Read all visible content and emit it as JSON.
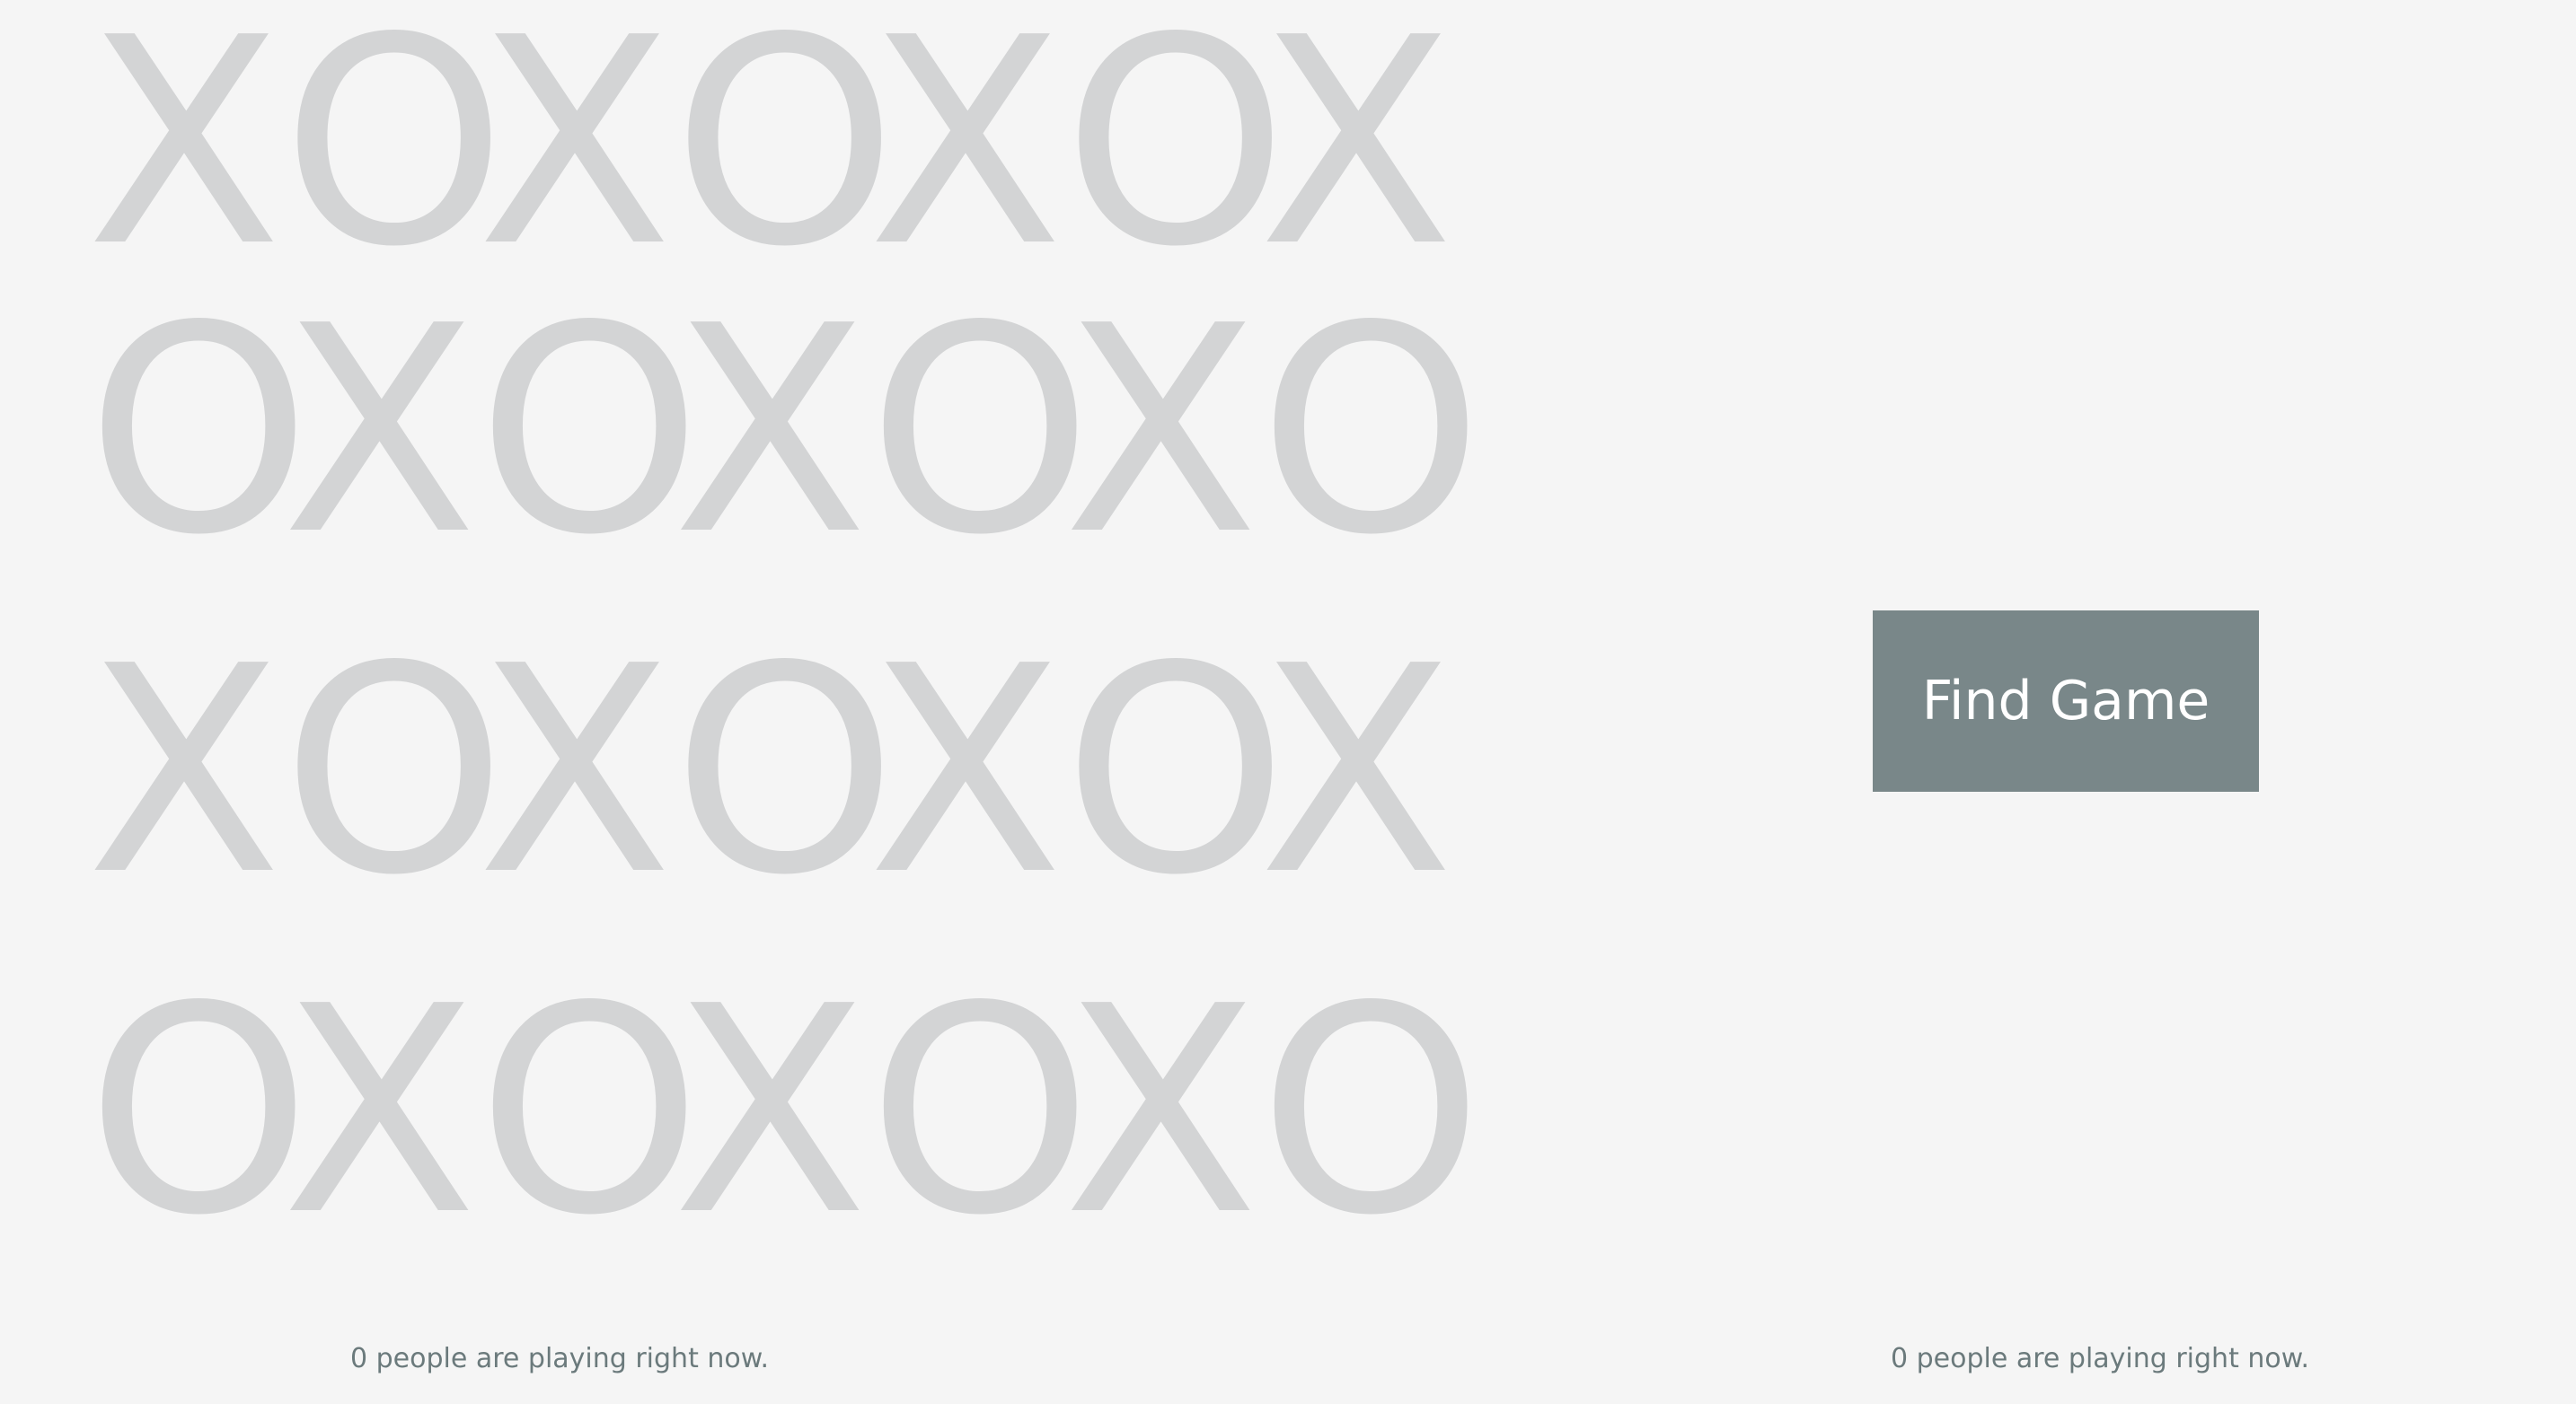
{
  "board": {
    "rows": [
      [
        "X",
        "O",
        "X",
        "O",
        "X",
        "O",
        "X"
      ],
      [
        "O",
        "X",
        "O",
        "X",
        "O",
        "X",
        "O"
      ],
      [
        "X",
        "O",
        "X",
        "O",
        "X",
        "O",
        "X"
      ],
      [
        "O",
        "X",
        "O",
        "X",
        "O",
        "X",
        "O"
      ]
    ]
  },
  "find_game_button": {
    "label": "Find Game"
  },
  "status": {
    "left_text": "0 people are playing right now.",
    "right_text": "0 people are playing right now."
  },
  "colors": {
    "background": "#f5f5f5",
    "letters": "#d3d4d5",
    "button": "#798789",
    "button_text": "#ffffff",
    "status_text": "#6b7a7c"
  }
}
